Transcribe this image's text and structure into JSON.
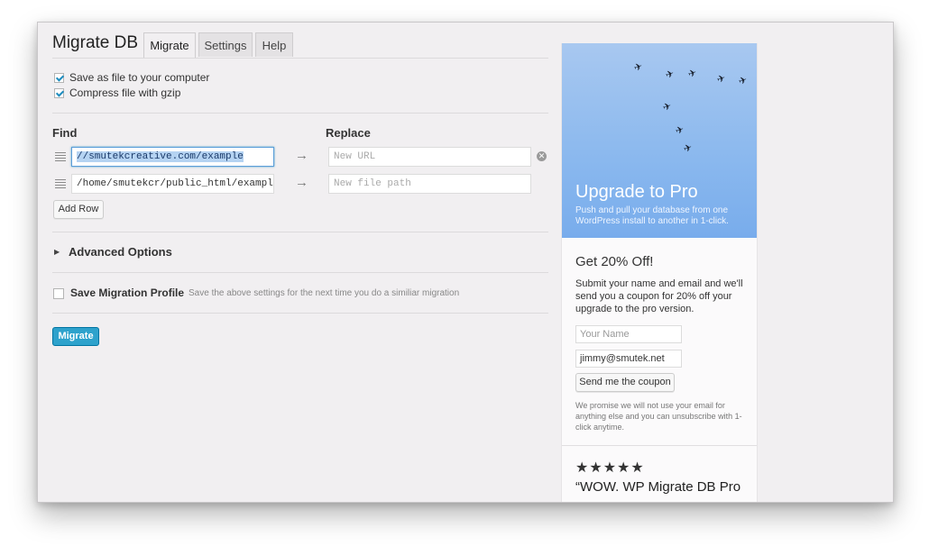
{
  "app": {
    "title": "Migrate DB"
  },
  "tabs": [
    {
      "label": "Migrate",
      "active": true
    },
    {
      "label": "Settings",
      "active": false
    },
    {
      "label": "Help",
      "active": false
    }
  ],
  "options": {
    "save_as_file": {
      "label": "Save as file to your computer",
      "checked": true
    },
    "compress": {
      "label": "Compress file with gzip",
      "checked": true
    }
  },
  "find_replace": {
    "find_heading": "Find",
    "replace_heading": "Replace",
    "rows": [
      {
        "find_value": "//smutekcreative.com/example",
        "replace_placeholder": "New URL"
      },
      {
        "find_value": "/home/smutekcr/public_html/example",
        "replace_placeholder": "New file path"
      }
    ],
    "add_row_label": "Add Row"
  },
  "advanced": {
    "label": "Advanced Options"
  },
  "profile": {
    "label": "Save Migration Profile",
    "hint": "Save the above settings for the next time you do a similiar migration",
    "checked": false
  },
  "migrate_button": "Migrate",
  "sidebar": {
    "promo_title": "Upgrade to Pro",
    "promo_subtitle": "Push and pull your database from one WordPress install to another in 1-click.",
    "offer_heading": "Get 20% Off!",
    "offer_text": "Submit your name and email and we'll send you a coupon for 20% off your upgrade to the pro version.",
    "name_placeholder": "Your Name",
    "email_value": "jimmy@smutek.net",
    "send_button": "Send me the coupon",
    "privacy_note": "We promise we will not use your email for anything else and you can unsubscribe with 1-click anytime.",
    "stars": "★★★★★",
    "quote": "“WOW. WP Migrate DB Pro"
  },
  "colors": {
    "accent": "#2ea2cc",
    "promo_blue": "#8ab8ee",
    "window_bg": "#f1eff1"
  }
}
